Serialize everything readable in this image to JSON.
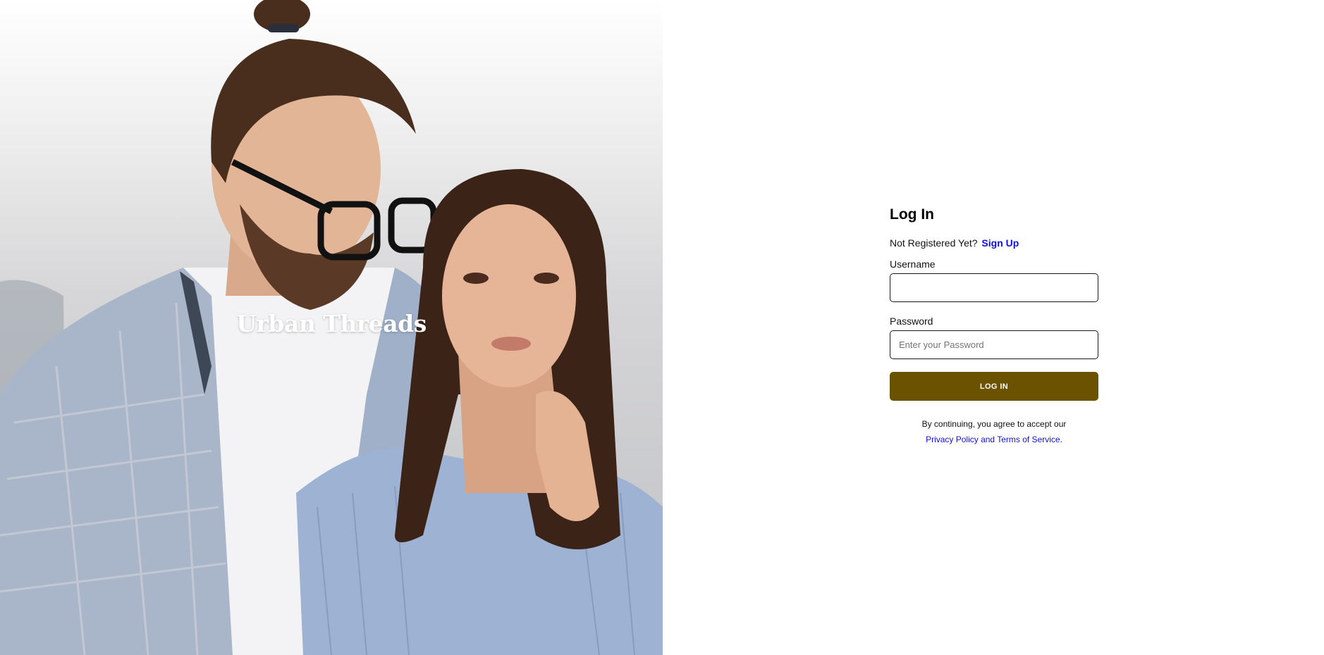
{
  "hero": {
    "brand": "Urban Threads",
    "image": "couple-fashion-photo"
  },
  "form": {
    "title": "Log In",
    "register_prompt": "Not Registered Yet?",
    "signup_link": "Sign Up",
    "username_label": "Username",
    "username_value": "",
    "username_placeholder": "",
    "password_label": "Password",
    "password_value": "",
    "password_placeholder": "Enter your Password",
    "login_button": "LOG IN",
    "terms_text": "By continuing, you agree to accept our",
    "terms_link": "Privacy Policy and Terms of Service."
  },
  "colors": {
    "accent_button": "#6b5200",
    "link": "#1010e0"
  }
}
